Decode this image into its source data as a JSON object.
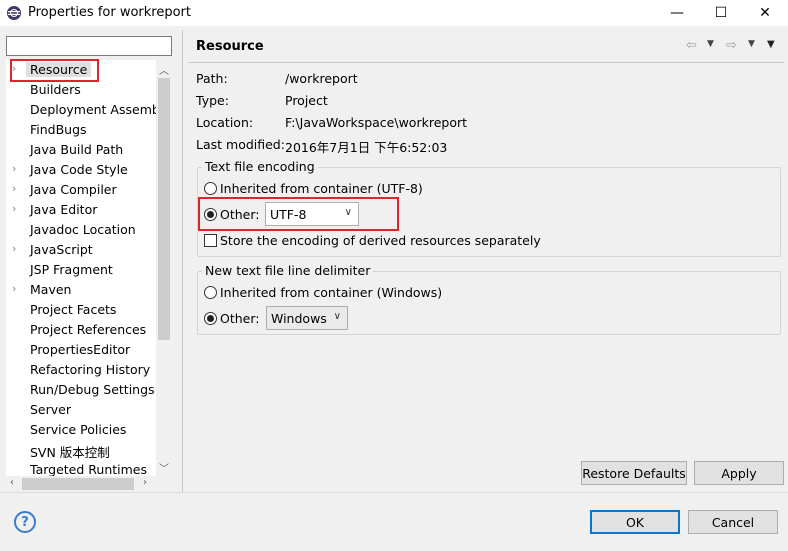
{
  "window": {
    "title": "Properties for workreport",
    "minimize_glyph": "—",
    "maximize_glyph": "☐",
    "close_glyph": "✕"
  },
  "sidebar": {
    "filter_placeholder": "",
    "items": [
      {
        "label": "Resource",
        "expandable": true,
        "selected": true
      },
      {
        "label": "Builders",
        "expandable": false
      },
      {
        "label": "Deployment Assembly",
        "expandable": false
      },
      {
        "label": "FindBugs",
        "expandable": false
      },
      {
        "label": "Java Build Path",
        "expandable": false
      },
      {
        "label": "Java Code Style",
        "expandable": true
      },
      {
        "label": "Java Compiler",
        "expandable": true
      },
      {
        "label": "Java Editor",
        "expandable": true
      },
      {
        "label": "Javadoc Location",
        "expandable": false
      },
      {
        "label": "JavaScript",
        "expandable": true
      },
      {
        "label": "JSP Fragment",
        "expandable": false
      },
      {
        "label": "Maven",
        "expandable": true
      },
      {
        "label": "Project Facets",
        "expandable": false
      },
      {
        "label": "Project References",
        "expandable": false
      },
      {
        "label": "PropertiesEditor",
        "expandable": false
      },
      {
        "label": "Refactoring History",
        "expandable": false
      },
      {
        "label": "Run/Debug Settings",
        "expandable": false
      },
      {
        "label": "Server",
        "expandable": false
      },
      {
        "label": "Service Policies",
        "expandable": false
      },
      {
        "label": "SVN 版本控制",
        "expandable": false
      },
      {
        "label": "Targeted Runtimes",
        "expandable": false
      }
    ]
  },
  "page": {
    "title": "Resource",
    "path_label": "Path:",
    "path_value": "/workreport",
    "type_label": "Type:",
    "type_value": "Project",
    "location_label": "Location:",
    "location_value": "F:\\JavaWorkspace\\workreport",
    "modified_label": "Last modified:",
    "modified_value": "2016年7月1日 下午6:52:03"
  },
  "encoding": {
    "group_title": "Text file encoding",
    "inherited_label": "Inherited from container (UTF-8)",
    "other_label": "Other:",
    "other_value": "UTF-8",
    "derived_label": "Store the encoding of derived resources separately"
  },
  "delimiter": {
    "group_title": "New text file line delimiter",
    "inherited_label": "Inherited from container (Windows)",
    "other_label": "Other:",
    "other_value": "Windows"
  },
  "buttons": {
    "restore_defaults": "Restore Defaults",
    "apply": "Apply",
    "ok": "OK",
    "cancel": "Cancel",
    "help": "?"
  },
  "colors": {
    "highlight": "#e0242b",
    "default_button": "#0078d7"
  }
}
